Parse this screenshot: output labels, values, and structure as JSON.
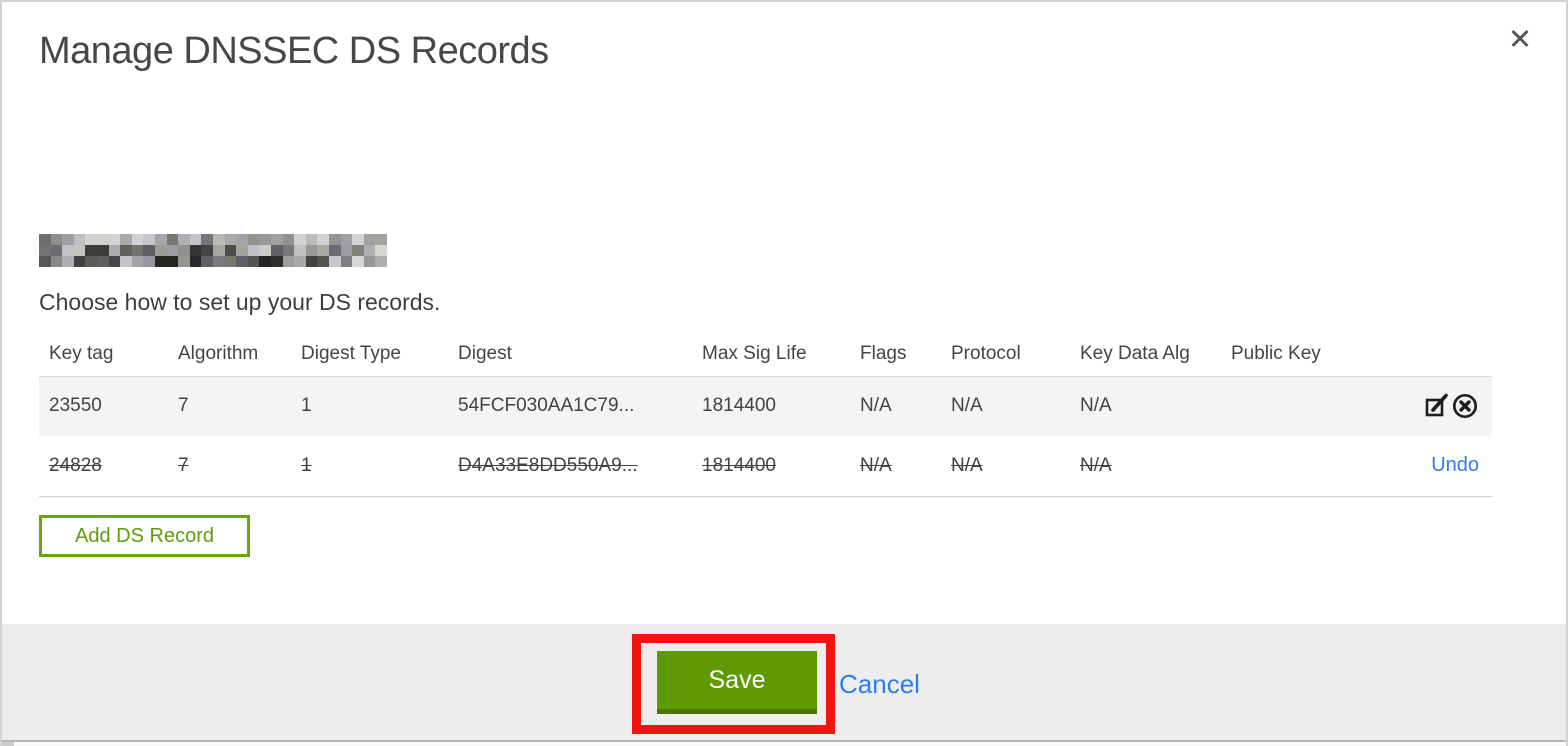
{
  "modal": {
    "title": "Manage DNSSEC DS Records",
    "close_icon": "✕",
    "domain": {
      "redacted": true
    },
    "instruction": "Choose how to set up your DS records."
  },
  "table": {
    "columns": {
      "key_tag": "Key tag",
      "algorithm": "Algorithm",
      "digest_type": "Digest Type",
      "digest": "Digest",
      "max_sig_life": "Max Sig Life",
      "flags": "Flags",
      "protocol": "Protocol",
      "key_data_alg": "Key Data Alg",
      "public_key": "Public Key"
    },
    "rows": [
      {
        "key_tag": "23550",
        "algorithm": "7",
        "digest_type": "1",
        "digest": "54FCF030AA1C79...",
        "max_sig_life": "1814400",
        "flags": "N/A",
        "protocol": "N/A",
        "key_data_alg": "N/A",
        "public_key": "",
        "state": "active"
      },
      {
        "key_tag": "24828",
        "algorithm": "7",
        "digest_type": "1",
        "digest": "D4A33E8DD550A9...",
        "max_sig_life": "1814400",
        "flags": "N/A",
        "protocol": "N/A",
        "key_data_alg": "N/A",
        "public_key": "",
        "state": "marked-for-deletion",
        "undo_label": "Undo"
      }
    ]
  },
  "buttons": {
    "add_ds_record": "Add DS Record",
    "save": "Save",
    "cancel": "Cancel"
  },
  "annotation": {
    "type": "highlight-rectangle",
    "target": "save-button",
    "color": "#f21313"
  },
  "colors": {
    "primary_green": "#619903",
    "outline_green": "#67a40e",
    "link_blue": "#2e7cf2",
    "footer_bg": "#ededed",
    "row_alt_bg": "#f4f4f4"
  }
}
